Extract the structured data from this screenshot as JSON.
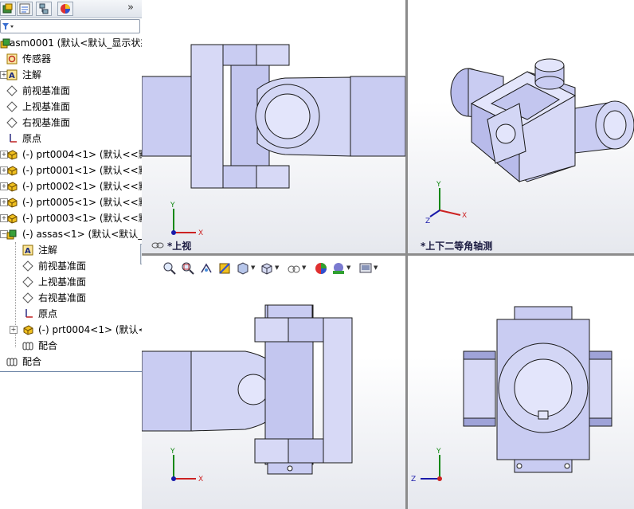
{
  "tree": {
    "root": "asm0001  (默认<默认_显示状态",
    "sensors": "传感器",
    "annotations": "注解",
    "front_plane": "前视基准面",
    "top_plane": "上视基准面",
    "right_plane": "右视基准面",
    "origin": "原点",
    "parts": [
      "(-) prt0004<1> (默认<<默",
      "(-) prt0001<1> (默认<<默",
      "(-) prt0002<1> (默认<<默",
      "(-) prt0005<1> (默认<<默",
      "(-) prt0003<1> (默认<<默"
    ],
    "subasm": {
      "label": "(-) assas<1> (默认<默认_",
      "annotations": "注解",
      "front_plane": "前视基准面",
      "top_plane": "上视基准面",
      "right_plane": "右视基准面",
      "origin": "原点",
      "part": "(-) prt0004<1> (默认<",
      "mates": "配合"
    },
    "mates": "配合"
  },
  "views": {
    "top": "*上视",
    "iso": "*上下二等角轴测",
    "front": "",
    "right": ""
  },
  "axes": {
    "x": "X",
    "y": "Y",
    "z": "Z"
  },
  "colors": {
    "part_fill": "#c9ccf2",
    "part_stroke": "#1a1a1a",
    "shade_dark": "#9fa3d8",
    "shade_light": "#e3e5fb",
    "axis_x": "#cc2222",
    "axis_y": "#118811",
    "axis_z": "#1a1aaa"
  }
}
